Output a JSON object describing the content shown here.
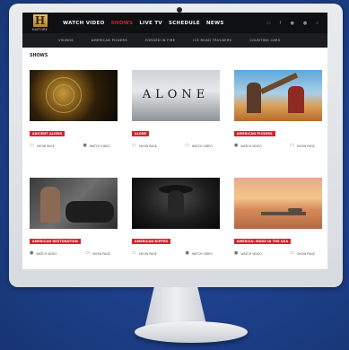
{
  "header": {
    "logo_letter": "H",
    "logo_text": "HISTORY",
    "nav": [
      "WATCH VIDEO",
      "SHOWS",
      "LIVE TV",
      "SCHEDULE",
      "NEWS"
    ],
    "active_nav": "SHOWS",
    "utils": [
      "TV",
      "f",
      "t",
      "g+",
      "search"
    ]
  },
  "subnav": [
    "VIKINGS",
    "AMERICAN PICKERS",
    "FORGED IN FIRE",
    "ICE ROAD TRUCKERS",
    "COUNTING CARS"
  ],
  "section_title": "SHOWS",
  "cards": [
    {
      "badge": "ANCIENT ALIENS",
      "actions": [
        "SHOW PAGE",
        "WATCH VIDEO"
      ]
    },
    {
      "badge": "ALONE",
      "thumb_title": "ALONE",
      "actions": [
        "SHOW PAGE",
        "WATCH VIDEO"
      ]
    },
    {
      "badge": "AMERICAN PICKERS",
      "actions": [
        "WATCH VIDEO",
        "SHOW PAGE"
      ]
    },
    {
      "badge": "AMERICAN RESTORATION",
      "actions": [
        "WATCH VIDEO",
        "SHOW PAGE"
      ]
    },
    {
      "badge": "AMERICAN RIPPER",
      "actions": [
        "SHOW PAGE",
        "WATCH VIDEO"
      ]
    },
    {
      "badge": "AMERICA: MADE IN THE USA",
      "actions": [
        "WATCH VIDEO",
        "SHOW PAGE"
      ]
    }
  ],
  "colors": {
    "accent": "#d8222d",
    "topbar": "#0f1012",
    "subbar": "#1b1c1f"
  }
}
